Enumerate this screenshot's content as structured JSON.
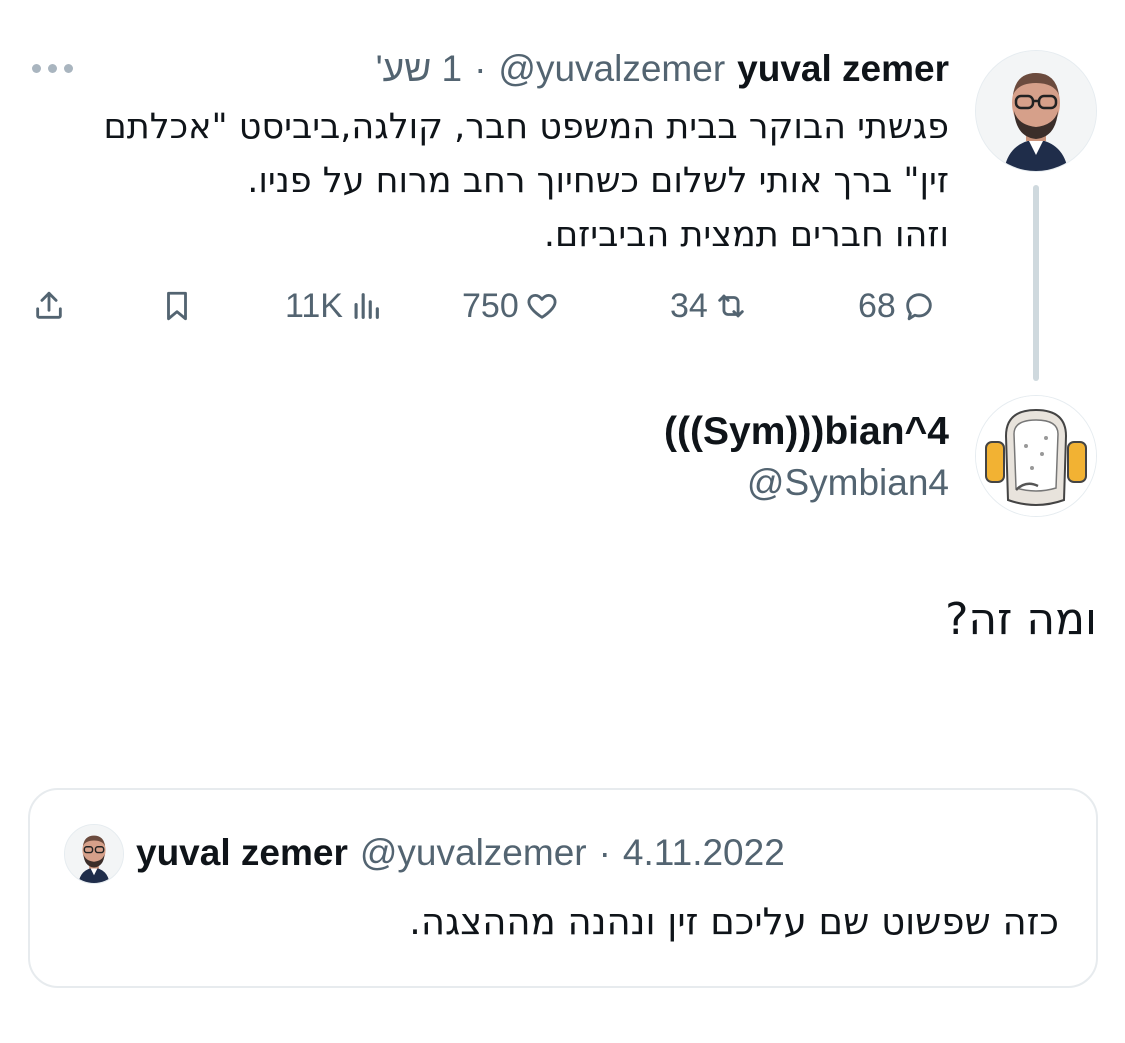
{
  "parent_tweet": {
    "author_name": "yuval zemer",
    "author_handle": "@yuvalzemer",
    "separator": "·",
    "time": "1 שע'",
    "more_icon": "more-dots-icon",
    "text_lines": [
      "פגשתי הבוקר בבית המשפט חבר, קולגה,ביביסט \"אכלתם",
      "זין\" ברך אותי לשלום כשחיוך רחב מרוח על פניו.",
      "וזהו חברים תמצית הביביזם."
    ],
    "actions": {
      "replies": "68",
      "retweets": "34",
      "likes": "750",
      "views": "11K"
    },
    "icons": {
      "reply": "reply-bubble-icon",
      "retweet": "retweet-icon",
      "like": "heart-icon",
      "views": "views-chart-icon",
      "bookmark": "bookmark-icon",
      "share": "share-icon"
    }
  },
  "reply_tweet": {
    "author_name": "(((Sym)))bian^4",
    "author_handle": "@Symbian4",
    "text": "ומה זה?"
  },
  "quoted_tweet": {
    "author_name": "yuval zemer",
    "author_handle": "@yuvalzemer",
    "separator": "·",
    "date": "4.11.2022",
    "text": "כזה שפשוט שם עליכם זין ונהנה מההצגה."
  },
  "colors": {
    "text_primary": "#0f1419",
    "text_secondary": "#536471",
    "thread_line": "#cfd9de",
    "card_border": "#e7ebee"
  }
}
